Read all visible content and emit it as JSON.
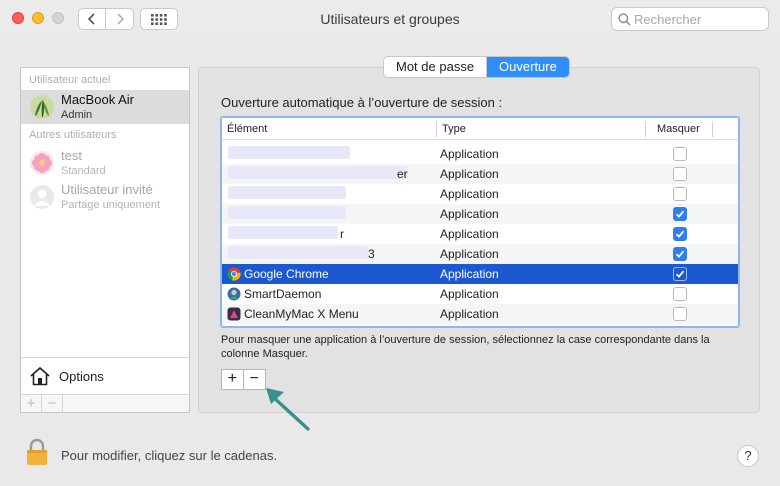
{
  "window": {
    "title": "Utilisateurs et groupes"
  },
  "search": {
    "placeholder": "Rechercher"
  },
  "sidebar": {
    "current_label": "Utilisateur actuel",
    "current_user": {
      "name": "MacBook Air",
      "role": "Admin"
    },
    "others_label": "Autres utilisateurs",
    "other_users": [
      {
        "name": "test",
        "role": "Standard"
      },
      {
        "name": "Utilisateur invité",
        "role": "Partage uniquement"
      }
    ],
    "options_label": "Options"
  },
  "tabs": {
    "password": "Mot de passe",
    "login": "Ouverture"
  },
  "login_items": {
    "heading": "Ouverture automatique à l’ouverture de session :",
    "columns": {
      "item": "Élément",
      "type": "Type",
      "hide": "Masquer"
    },
    "rows": [
      {
        "name": "",
        "type": "Application",
        "hide": false
      },
      {
        "name": "er",
        "type": "Application",
        "hide": false
      },
      {
        "name": "",
        "type": "Application",
        "hide": false
      },
      {
        "name": "",
        "type": "Application",
        "hide": true
      },
      {
        "name": "r",
        "type": "Application",
        "hide": true
      },
      {
        "name": "3",
        "type": "Application",
        "hide": true
      },
      {
        "name": "Google Chrome",
        "type": "Application",
        "hide": true
      },
      {
        "name": "SmartDaemon",
        "type": "Application",
        "hide": false
      },
      {
        "name": "CleanMyMac X Menu",
        "type": "Application",
        "hide": false
      }
    ],
    "hint": "Pour masquer une application à l’ouverture de session, sélectionnez la case correspondante dans la colonne Masquer.",
    "add_label": "+",
    "remove_label": "−"
  },
  "footer": {
    "lock_text": "Pour modifier, cliquez sur le cadenas.",
    "help_label": "?"
  },
  "colors": {
    "accent": "#2f8ef8",
    "selection": "#1c58cf",
    "arrow": "#3b8f8a"
  }
}
